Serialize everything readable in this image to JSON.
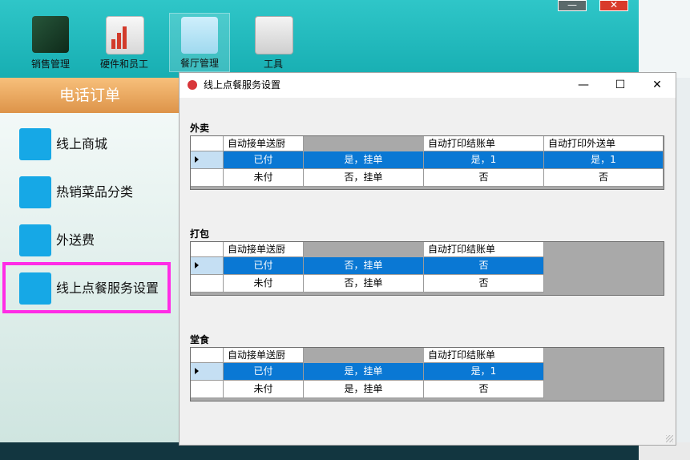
{
  "toolbar": {
    "items": [
      {
        "label": "销售管理",
        "icon": "ledger-book-icon"
      },
      {
        "label": "硬件和员工",
        "icon": "staff-chart-icon"
      },
      {
        "label": "餐厅管理",
        "icon": "dining-table-icon",
        "active": true
      },
      {
        "label": "工具",
        "icon": "devices-icon"
      }
    ]
  },
  "window_controls": {
    "minimize": "—",
    "close": "✕"
  },
  "sidebar": {
    "header": "电话订单",
    "items": [
      {
        "label": "线上商城"
      },
      {
        "label": "热销菜品分类"
      },
      {
        "label": "外送费"
      },
      {
        "label": "线上点餐服务设置",
        "highlighted": true
      }
    ]
  },
  "dialog": {
    "title": "线上点餐服务设置",
    "buttons": {
      "minimize": "—",
      "maximize": "☐",
      "close": "✕"
    },
    "sections": [
      {
        "label": "外卖",
        "columns": [
          "",
          "自动接单送厨",
          "自动打印结账单",
          "自动打印外送单"
        ],
        "rows": [
          {
            "selected": true,
            "cells": [
              "已付",
              "是，挂单",
              "是，1",
              "是，1"
            ]
          },
          {
            "selected": false,
            "cells": [
              "未付",
              "否，挂单",
              "否",
              "否"
            ]
          }
        ]
      },
      {
        "label": "打包",
        "columns": [
          "",
          "自动接单送厨",
          "自动打印结账单"
        ],
        "rows": [
          {
            "selected": true,
            "cells": [
              "已付",
              "否，挂单",
              "否"
            ]
          },
          {
            "selected": false,
            "cells": [
              "未付",
              "否，挂单",
              "否"
            ]
          }
        ]
      },
      {
        "label": "堂食",
        "columns": [
          "",
          "自动接单送厨",
          "自动打印结账单"
        ],
        "rows": [
          {
            "selected": true,
            "cells": [
              "已付",
              "是，挂单",
              "是，1"
            ]
          },
          {
            "selected": false,
            "cells": [
              "未付",
              "是，挂单",
              "否"
            ]
          }
        ]
      }
    ]
  },
  "colors": {
    "teal": "#17aeb2",
    "selection": "#0a78d4",
    "highlight": "#ff2ce6",
    "tile": "#16a8e6"
  }
}
